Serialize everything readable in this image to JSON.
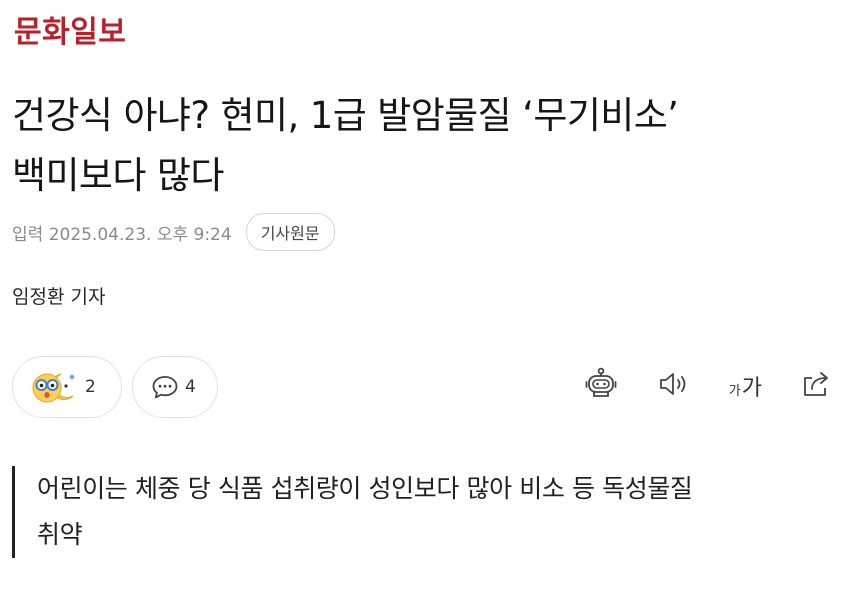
{
  "publisher": {
    "name": "문화일보",
    "brand_color": "#b8202a"
  },
  "article": {
    "title_line1": "건강식 아냐? 현미, 1급 발암물질 ‘무기비소’",
    "title_line2": "백미보다 많다",
    "published_label": "입력",
    "published_time": "2025.04.23. 오후 9:24",
    "original_button": "기사원문",
    "author": "임정환 기자",
    "subheading_line1": "어린이는 체중 당 식품 섭취량이 성인보다 많아 비소 등 독성물질",
    "subheading_line2": "취약"
  },
  "actions": {
    "reactions": {
      "icon": "reaction-emoji-icon",
      "count": "2"
    },
    "comments": {
      "icon": "speech-bubble-icon",
      "count": "4"
    },
    "tools": [
      {
        "icon": "robot-summary-icon"
      },
      {
        "icon": "speaker-icon"
      },
      {
        "small": "가",
        "large": "가",
        "icon": "font-size-icon"
      },
      {
        "icon": "share-icon"
      }
    ]
  }
}
